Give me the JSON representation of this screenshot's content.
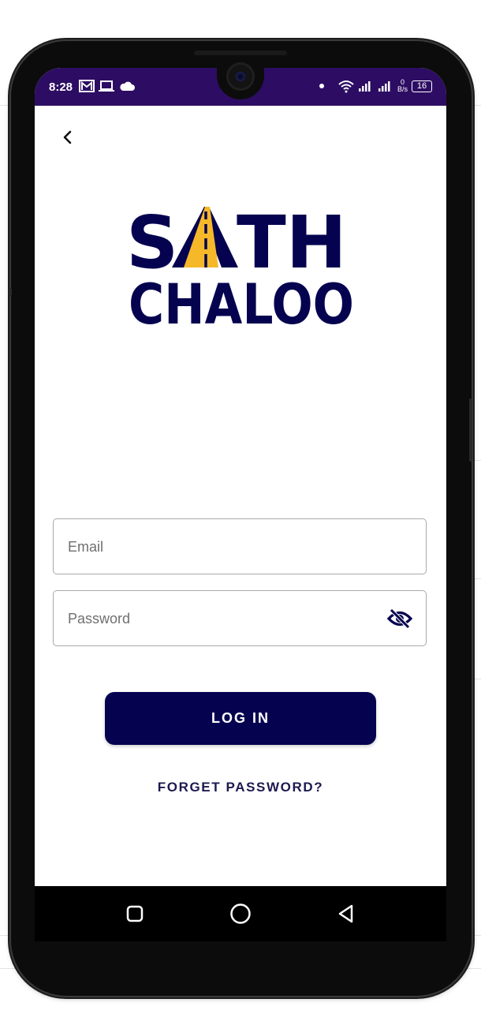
{
  "status_bar": {
    "time": "8:28",
    "data_rate_value": "0",
    "data_rate_unit": "B/s",
    "battery_level": "16",
    "icons": [
      "gmail-icon",
      "laptop-icon",
      "cloud-icon",
      "dot-icon",
      "wifi-icon",
      "signal-icon",
      "battery-icon"
    ],
    "background_color": "#2d0d63"
  },
  "logo": {
    "line1": "SATH",
    "line2": "CHALOO",
    "color": "#05034f",
    "accent_color": "#f5b829"
  },
  "form": {
    "email_placeholder": "Email",
    "password_placeholder": "Password",
    "toggle_icon": "eye-off-icon"
  },
  "actions": {
    "login_label": "LOG IN",
    "forgot_label": "FORGET PASSWORD?"
  },
  "nav": {
    "icons": [
      "back-icon",
      "square-icon",
      "circle-icon",
      "triangle-icon"
    ]
  },
  "colors": {
    "primary": "#05034f",
    "border": "#a9a9a9"
  }
}
